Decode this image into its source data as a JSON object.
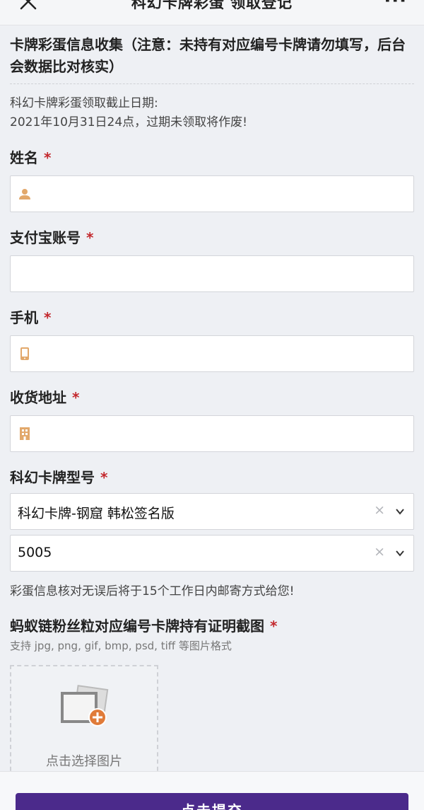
{
  "header": {
    "title": "科幻卡牌彩蛋 领取登记",
    "more_label": "···"
  },
  "notice": "卡牌彩蛋信息收集（注意：未持有对应编号卡牌请勿填写，后台会数据比对核实）",
  "deadline": {
    "line1": "科幻卡牌彩蛋领取截止日期:",
    "line2": "2021年10月31日24点，过期未领取将作废!"
  },
  "required_mark": "*",
  "fields": {
    "name": {
      "label": "姓名",
      "value": "",
      "icon": "person-icon"
    },
    "alipay": {
      "label": "支付宝账号",
      "value": ""
    },
    "phone": {
      "label": "手机",
      "value": "",
      "icon": "phone-icon"
    },
    "address": {
      "label": "收货地址",
      "value": "",
      "icon": "building-icon"
    },
    "card_model": {
      "label": "科幻卡牌型号",
      "select1_value": "科幻卡牌-钢窟 韩松签名版",
      "select2_value": "5005",
      "clear_label": "×"
    }
  },
  "mail_hint": "彩蛋信息核对无误后将于15个工作日内邮寄方式给您!",
  "upload": {
    "label": "蚂蚁链粉丝粒对应编号卡牌持有证明截图",
    "formats": "支持 jpg, png, gif, bmp, psd, tiff 等图片格式",
    "button_text": "点击选择图片"
  },
  "submit_label": "点击提交",
  "colors": {
    "accent": "#4b2a8b",
    "required": "#c3282d",
    "icon": "#e2a86b",
    "upload_plus": "#e07b39"
  }
}
